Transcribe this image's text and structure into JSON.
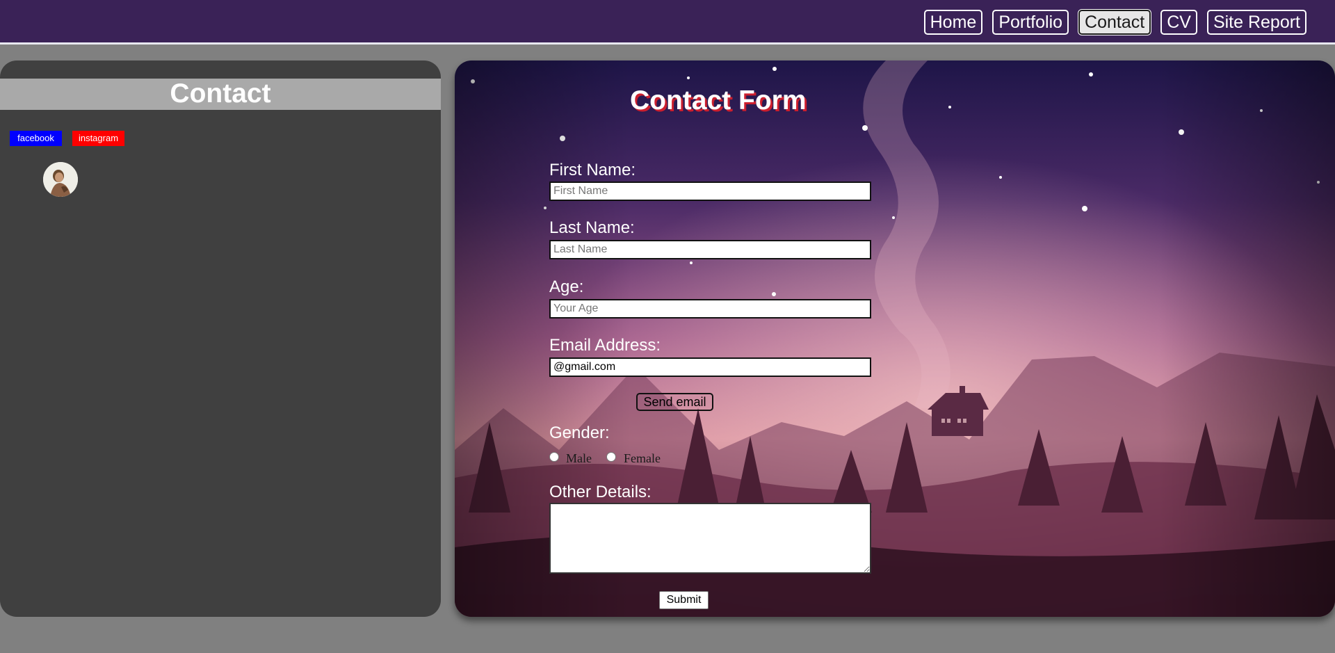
{
  "nav": {
    "items": [
      {
        "label": "Home",
        "active": false
      },
      {
        "label": "Portfolio",
        "active": false
      },
      {
        "label": "Contact",
        "active": true
      },
      {
        "label": "CV",
        "active": false
      },
      {
        "label": "Site Report",
        "active": false
      }
    ]
  },
  "left": {
    "title": "Contact",
    "social": {
      "facebook": "facebook",
      "instagram": "instagram"
    }
  },
  "form": {
    "title": "Contact Form",
    "first_name": {
      "label": "First Name:",
      "placeholder": "First Name",
      "value": ""
    },
    "last_name": {
      "label": "Last Name:",
      "placeholder": "Last Name",
      "value": ""
    },
    "age": {
      "label": "Age:",
      "placeholder": "Your Age",
      "value": ""
    },
    "email": {
      "label": "Email Address:",
      "placeholder": "",
      "value": "@gmail.com"
    },
    "send_email_label": "Send email",
    "gender": {
      "label": "Gender:",
      "options": [
        "Male",
        "Female"
      ]
    },
    "other_details": {
      "label": "Other Details:"
    },
    "submit_label": "Submit"
  },
  "colors": {
    "nav_bg": "#3a2257",
    "page_bg": "#808080",
    "left_panel_bg": "#404040",
    "left_title_bar": "#a9a9a9",
    "facebook_bg": "#0000ff",
    "instagram_bg": "#ff0000",
    "title_shadow": "#cc1f2e"
  }
}
